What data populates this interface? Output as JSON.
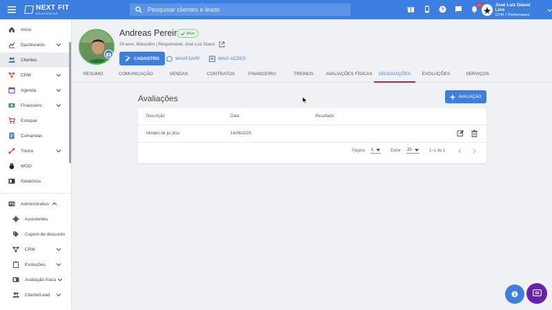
{
  "topbar": {
    "logo_title": "NEXT FIT",
    "logo_sub": "ACADEMIAS",
    "search_placeholder": "Pesquisar clientes e leads",
    "notification_count": "21",
    "user_name": "José Luiz Giassi Lino",
    "user_gym": "GYM 7 Performance"
  },
  "sidebar": {
    "items": [
      {
        "label": "Início",
        "icon": "home-icon"
      },
      {
        "label": "Dashboards",
        "icon": "chart-icon"
      },
      {
        "label": "Clientes",
        "icon": "people-icon"
      },
      {
        "label": "CRM",
        "icon": "crm-icon"
      },
      {
        "label": "Agenda",
        "icon": "calendar-icon"
      },
      {
        "label": "Financeiro",
        "icon": "money-icon"
      },
      {
        "label": "Estoque",
        "icon": "cart-icon"
      },
      {
        "label": "Comandas",
        "icon": "receipt-icon"
      },
      {
        "label": "Treino",
        "icon": "dumbbell-icon"
      },
      {
        "label": "WOD",
        "icon": "kettlebell-icon"
      },
      {
        "label": "Relatórios",
        "icon": "report-icon"
      }
    ],
    "admin_label": "Administrativo",
    "admin_items": [
      {
        "label": "Assistentes"
      },
      {
        "label": "Cupom de desconto"
      },
      {
        "label": "CRM"
      },
      {
        "label": "Evoluções"
      },
      {
        "label": "Avaliação física"
      },
      {
        "label": "Cliente/Lead"
      }
    ]
  },
  "profile": {
    "name": "Andreas Pereira",
    "status": "Ativo",
    "info": "29 anos, Masculino | Responsável: José Luiz Giassi",
    "btn_cadastro": "CADASTRO",
    "btn_whatsapp": "WHATSAPP",
    "btn_more": "MAIS AÇÕES"
  },
  "tabs": [
    "RESUMO",
    "COMUNICAÇÃO",
    "VENDAS",
    "CONTRATOS",
    "FINANCEIRO",
    "TREINOS",
    "AVALIAÇÕES FÍSICAS",
    "GRADUAÇÕES",
    "EVOLUÇÕES",
    "SERVIÇOS"
  ],
  "active_tab": "GRADUAÇÕES",
  "section": {
    "title": "Avaliações",
    "add_button": "AVALIAÇÃO"
  },
  "table": {
    "headers": [
      "Descrição",
      "Data",
      "Resultado"
    ],
    "rows": [
      {
        "descricao": "Modelo de jiu jitsu",
        "data": "14/08/2025",
        "resultado": ""
      }
    ]
  },
  "pager": {
    "page_label": "Página",
    "page_value": "1",
    "show_label": "Exibir",
    "show_value": "20",
    "range": "1–1 de 1"
  },
  "colors": {
    "primary": "#3d7fe0",
    "active_tab_underline": "#c2185b",
    "status_green": "#3a8e3a",
    "chat_fab": "#6a1fb3"
  }
}
